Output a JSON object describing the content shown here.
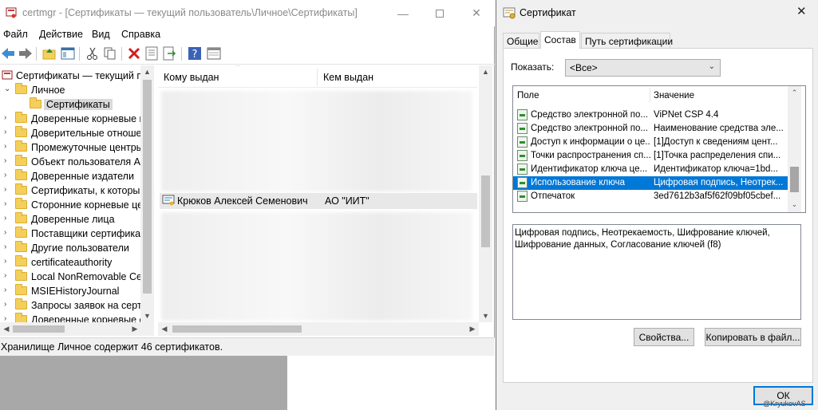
{
  "certmgr": {
    "title": "certmgr - [Сертификаты — текущий пользователь\\Личное\\Сертификаты]",
    "menu": [
      "Файл",
      "Действие",
      "Вид",
      "Справка"
    ],
    "tree": {
      "root": "Сертификаты — текущий по",
      "personal": "Личное",
      "certificates": "Сертификаты",
      "folders": [
        "Доверенные корневые це",
        "Доверительные отношен",
        "Промежуточные центры",
        "Объект пользователя Act",
        "Доверенные издатели",
        "Сертификаты, к которым",
        "Сторонние корневые цен",
        "Доверенные лица",
        "Поставщики сертификат",
        "Другие пользователи",
        "certificateauthority",
        "Local NonRemovable Cert",
        "MSIEHistoryJournal",
        "Запросы заявок на серти",
        "Доверенные корневые с"
      ]
    },
    "list": {
      "columns": [
        "Кому выдан",
        "Кем выдан"
      ],
      "visible_row": {
        "issued_to": "Крюков Алексей Семенович",
        "issued_by": "АО \"ИИТ\""
      }
    },
    "status": "Хранилище Личное содержит 46 сертификатов."
  },
  "dialog": {
    "title": "Сертификат",
    "tabs": [
      "Общие",
      "Состав",
      "Путь сертификации"
    ],
    "active_tab": "Состав",
    "show_label": "Показать:",
    "show_value": "<Все>",
    "columns": [
      "Поле",
      "Значение"
    ],
    "fields": [
      {
        "name": "Средство электронной по...",
        "value": "ViPNet CSP 4.4"
      },
      {
        "name": "Средство электронной по...",
        "value": "Наименование средства эле..."
      },
      {
        "name": "Доступ к информации о це...",
        "value": "[1]Доступ к сведениям цент..."
      },
      {
        "name": "Точки распространения сп...",
        "value": "[1]Точка распределения спи..."
      },
      {
        "name": "Идентификатор ключа це...",
        "value": "Идентификатор ключа=1bd..."
      },
      {
        "name": "Использование ключа",
        "value": "Цифровая подпись, Неотрек..."
      },
      {
        "name": "Отпечаток",
        "value": "3ed7612b3af5f62f09bf05cbef..."
      }
    ],
    "selected_index": 5,
    "detail_text": "Цифровая подпись, Неотрекаемость, Шифрование ключей, Шифрование данных, Согласование ключей (f8)",
    "properties_button": "Свойства...",
    "copy_button": "Копировать в файл...",
    "ok_button": "ОК",
    "watermark": "@KryukovAS"
  }
}
